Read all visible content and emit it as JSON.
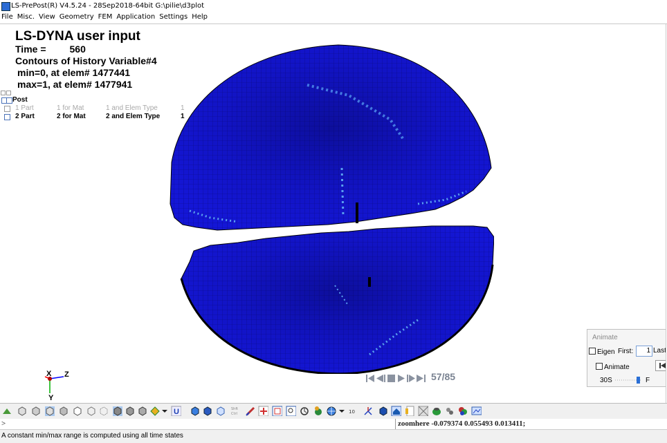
{
  "window": {
    "title": "LS-PrePost(R) V4.5.24 - 28Sep2018-64bit G:\\pilie\\d3plot"
  },
  "menu": [
    "File",
    "Misc.",
    "View",
    "Geometry",
    "FEM",
    "Application",
    "Settings",
    "Help"
  ],
  "header": {
    "title": "LS-DYNA user input",
    "time_label": "Time =",
    "time_value": "560",
    "contour": "Contours of History Variable#4",
    "min": "min=0, at elem# 1477441",
    "max": "max=1, at elem# 1477941"
  },
  "tree": {
    "root": "Post",
    "rows": [
      {
        "part": "1 Part",
        "mat": "1 for Mat",
        "elem": "1 and Elem Type",
        "num": "1",
        "active": false
      },
      {
        "part": "2 Part",
        "mat": "2 for Mat",
        "elem": "2 and Elem Type",
        "num": "1",
        "active": true
      }
    ]
  },
  "player": {
    "frame": "57/85"
  },
  "animate_panel": {
    "caption": "Animate",
    "eigen_label": "Eigen",
    "first_label": "First:",
    "first_value": "1",
    "last_label": "Last",
    "animate_label": "Animate",
    "speed_label": "30S",
    "speed_end": "F"
  },
  "axis": {
    "x": "X",
    "y": "Y",
    "z": "Z"
  },
  "toolbar": {
    "icons": [
      "select-icon",
      "cube-view-icon",
      "cube-view-2-icon",
      "cube-view-3-icon",
      "cube-view-4-icon",
      "cube-view-5-icon",
      "cube-view-6-icon",
      "cube-dots-icon",
      "cube-render-icon",
      "cube-render-2-icon",
      "cube-render-3-icon",
      "diamond-icon",
      "dropdown-icon",
      "u-icon",
      "box-blue-icon",
      "box-blue-2-icon",
      "box-outline-icon",
      "shift-ctrl-icon",
      "pointer-icon",
      "plus-icon",
      "zoom-box-icon",
      "zoom-icon",
      "rotate-icon",
      "sphere-icon",
      "globe-icon",
      "dropdown-2-icon",
      "ten-icon",
      "axis-icon",
      "cube-shade-icon",
      "house-icon",
      "note-icon",
      "pattern-icon",
      "green-ball-icon",
      "tools-icon",
      "colors-icon",
      "screen-icon"
    ],
    "ten_label": "10",
    "shift_label": "Shft",
    "ctrl_label": "Ctrl"
  },
  "command": {
    "prompt": ">",
    "output": "zoomhere -0.079374 0.055493 0.013411;"
  },
  "status": {
    "text": "A constant min/max range is computed using all time states"
  },
  "colors": {
    "mesh_blue": "#1416d6",
    "highlight": "#3f7fe0",
    "background": "#ffffff"
  }
}
